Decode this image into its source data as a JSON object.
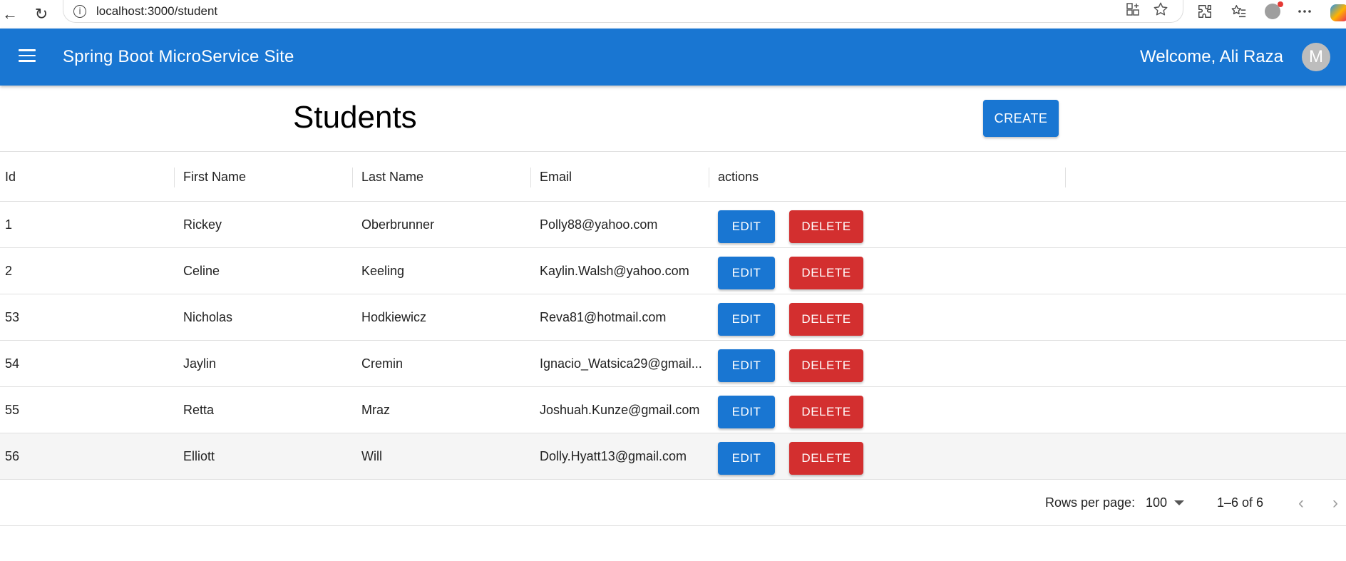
{
  "browser": {
    "url": "localhost:3000/student",
    "back_icon": "←",
    "reload_icon": "↻",
    "info_icon": "i"
  },
  "appbar": {
    "title": "Spring Boot MicroService Site",
    "welcome": "Welcome, Ali Raza",
    "avatar_letter": "M",
    "color": "#1976d2"
  },
  "page": {
    "title": "Students",
    "create_label": "CREATE"
  },
  "table": {
    "columns": [
      "Id",
      "First Name",
      "Last Name",
      "Email",
      "actions"
    ],
    "rows": [
      {
        "id": "1",
        "first": "Rickey",
        "last": "Oberbrunner",
        "email": "Polly88@yahoo.com"
      },
      {
        "id": "2",
        "first": "Celine",
        "last": "Keeling",
        "email": "Kaylin.Walsh@yahoo.com"
      },
      {
        "id": "53",
        "first": "Nicholas",
        "last": "Hodkiewicz",
        "email": "Reva81@hotmail.com"
      },
      {
        "id": "54",
        "first": "Jaylin",
        "last": "Cremin",
        "email": "Ignacio_Watsica29@gmail..."
      },
      {
        "id": "55",
        "first": "Retta",
        "last": "Mraz",
        "email": "Joshuah.Kunze@gmail.com"
      },
      {
        "id": "56",
        "first": "Elliott",
        "last": "Will",
        "email": "Dolly.Hyatt13@gmail.com"
      }
    ],
    "edit_label": "EDIT",
    "delete_label": "DELETE",
    "edit_color": "#1976d2",
    "delete_color": "#d32f2f"
  },
  "footer": {
    "rows_per_page_label": "Rows per page:",
    "rows_per_page_value": "100",
    "range_label": "1–6 of 6",
    "prev_icon": "‹",
    "next_icon": "›"
  }
}
